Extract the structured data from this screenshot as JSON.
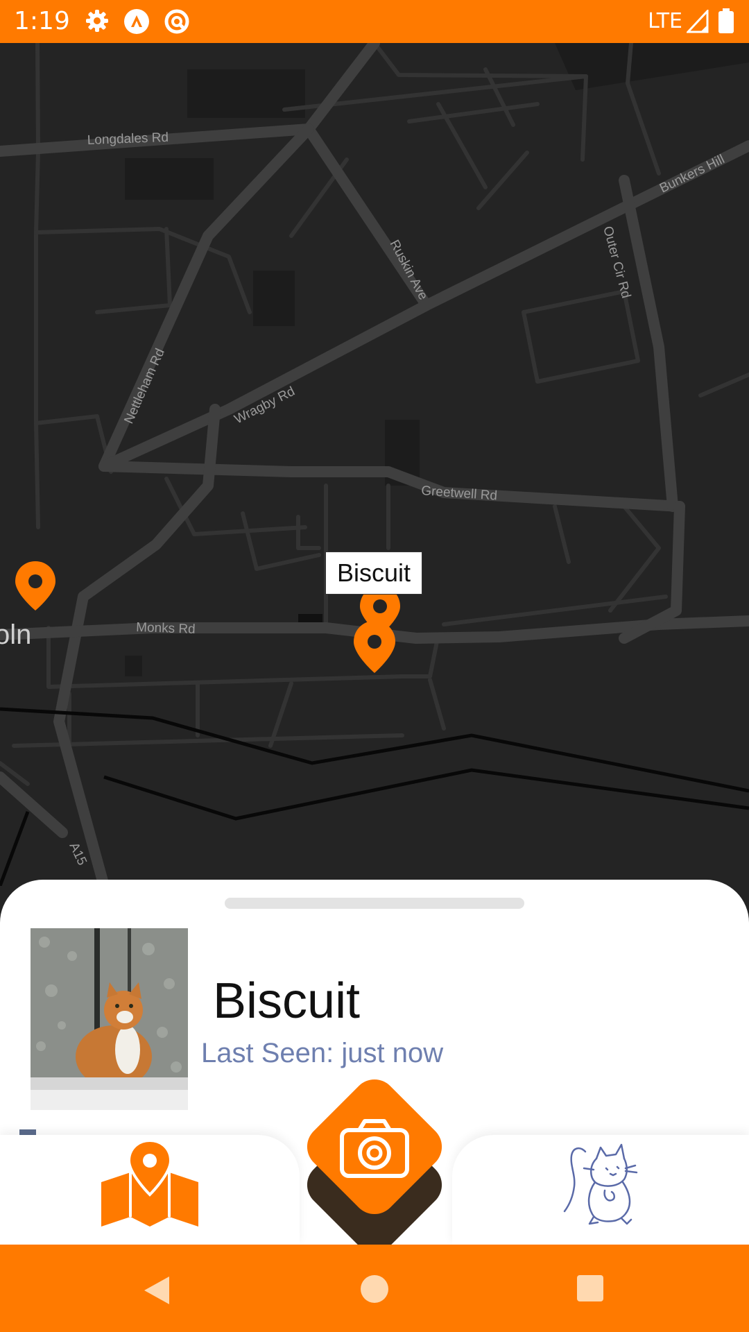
{
  "status_bar": {
    "time": "1:19",
    "network": "LTE",
    "icons": [
      "settings-gear-icon",
      "a-logo-icon",
      "no-entry-icon",
      "signal-icon",
      "battery-icon"
    ]
  },
  "map": {
    "streets": [
      "Longdales Rd",
      "Ruskin Ave",
      "Bunkers Hill",
      "Outer Cir Rd",
      "Nettleham Rd",
      "Wragby Rd",
      "Greetwell Rd",
      "Monks Rd",
      "A15"
    ],
    "partial_label": "oln",
    "callout": "Biscuit",
    "marker_color": "#FF7A00"
  },
  "pet_card": {
    "name": "Biscuit",
    "last_seen": "Last Seen: just now",
    "photo": "orange-and-white-cat-photo"
  },
  "bottom_nav": {
    "map_tab": "map-icon",
    "camera_button": "camera-icon",
    "cats_tab": "cat-drawing-icon"
  },
  "system_nav": [
    "back-icon",
    "home-icon",
    "recents-icon"
  ],
  "colors": {
    "accent": "#FF7A00",
    "map_bg": "#242424",
    "last_seen_text": "#6E7FAF"
  }
}
